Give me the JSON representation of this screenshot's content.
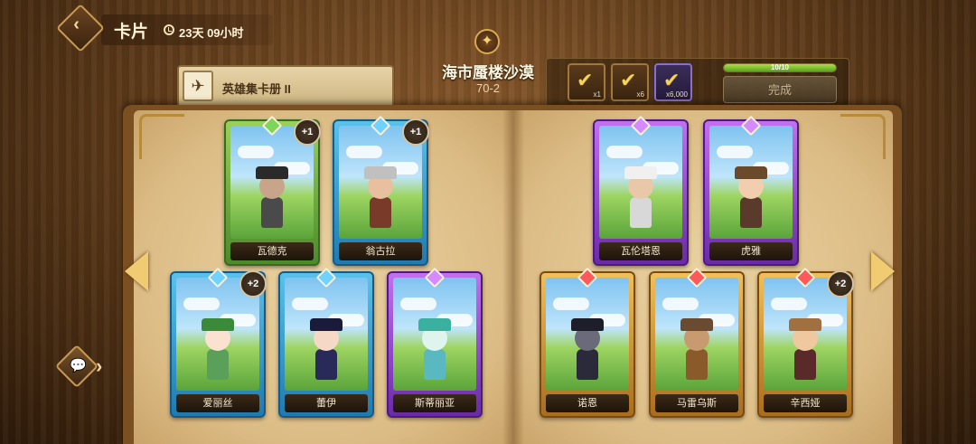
{
  "header": {
    "title": "卡片",
    "timer": "23天 09小时",
    "back_icon": "back-arrow-icon"
  },
  "album": {
    "title": "英雄集卡册 II"
  },
  "stage": {
    "name": "海市蜃楼沙漠",
    "code": "70-2"
  },
  "rewards": [
    {
      "qty": "x1",
      "icon": "check-icon"
    },
    {
      "qty": "x6",
      "icon": "check-icon"
    },
    {
      "qty": "x6,000",
      "icon": "check-icon"
    }
  ],
  "progress": {
    "text": "10/10",
    "fraction": 1.0
  },
  "complete_label": "完成",
  "cards": [
    {
      "name": "瓦德克",
      "badge": "+1",
      "rarity": "green"
    },
    {
      "name": "翁古拉",
      "badge": "+1",
      "rarity": "blue"
    },
    {
      "name": "爱丽丝",
      "badge": "+2",
      "rarity": "blue"
    },
    {
      "name": "蕾伊",
      "badge": "",
      "rarity": "blue"
    },
    {
      "name": "斯蒂丽亚",
      "badge": "",
      "rarity": "purple"
    },
    {
      "name": "瓦伦塔恩",
      "badge": "",
      "rarity": "purple"
    },
    {
      "name": "虎雅",
      "badge": "",
      "rarity": "purple"
    },
    {
      "name": "诺恩",
      "badge": "",
      "rarity": "gold"
    },
    {
      "name": "马雷乌斯",
      "badge": "",
      "rarity": "gold"
    },
    {
      "name": "辛西娅",
      "badge": "+2",
      "rarity": "gold"
    }
  ],
  "colors": {
    "green": "#4b8a2a",
    "blue": "#1f7ab0",
    "purple": "#6a2aa8",
    "gold": "#a86d1e",
    "progress": "#8fd040"
  }
}
